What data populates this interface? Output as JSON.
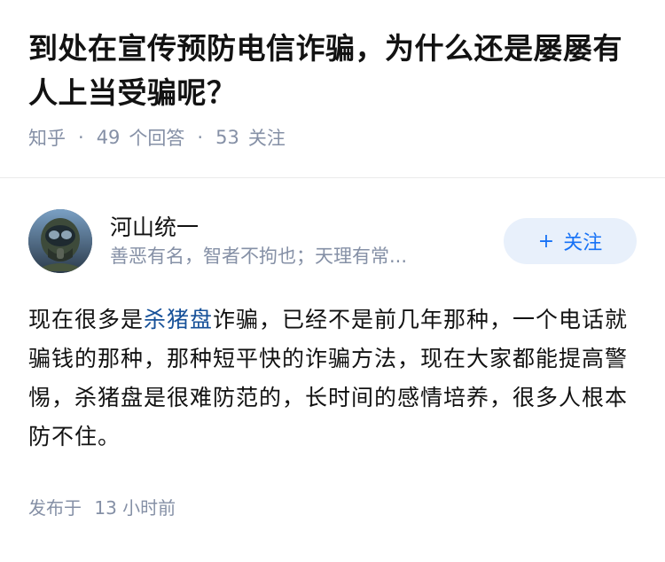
{
  "question": {
    "title": "到处在宣传预防电信诈骗，为什么还是屡屡有人上当受骗呢？",
    "source": "知乎",
    "answers_count": "49",
    "answers_label": "个回答",
    "followers_count": "53",
    "followers_label": "关注"
  },
  "answer": {
    "author_name": "河山统一",
    "author_bio": "善恶有名，智者不拘也；天理有常...",
    "follow_label": "关注",
    "follow_icon": "plus-icon",
    "content_prefix": "现在很多是",
    "content_link": "杀猪盘",
    "content_rest": "诈骗，已经不是前几年那种，一个电话就骗钱的那种，那种短平快的诈骗方法，现在大家都能提高警惕，杀猪盘是很难防范的，长时间的感情培养，很多人根本防不住。",
    "published_label": "发布于",
    "published_time": "13 小时前"
  },
  "colors": {
    "link": "#175199",
    "meta": "#8590a6",
    "follow_text": "#1772f6",
    "follow_bg": "#e8f0fb"
  }
}
